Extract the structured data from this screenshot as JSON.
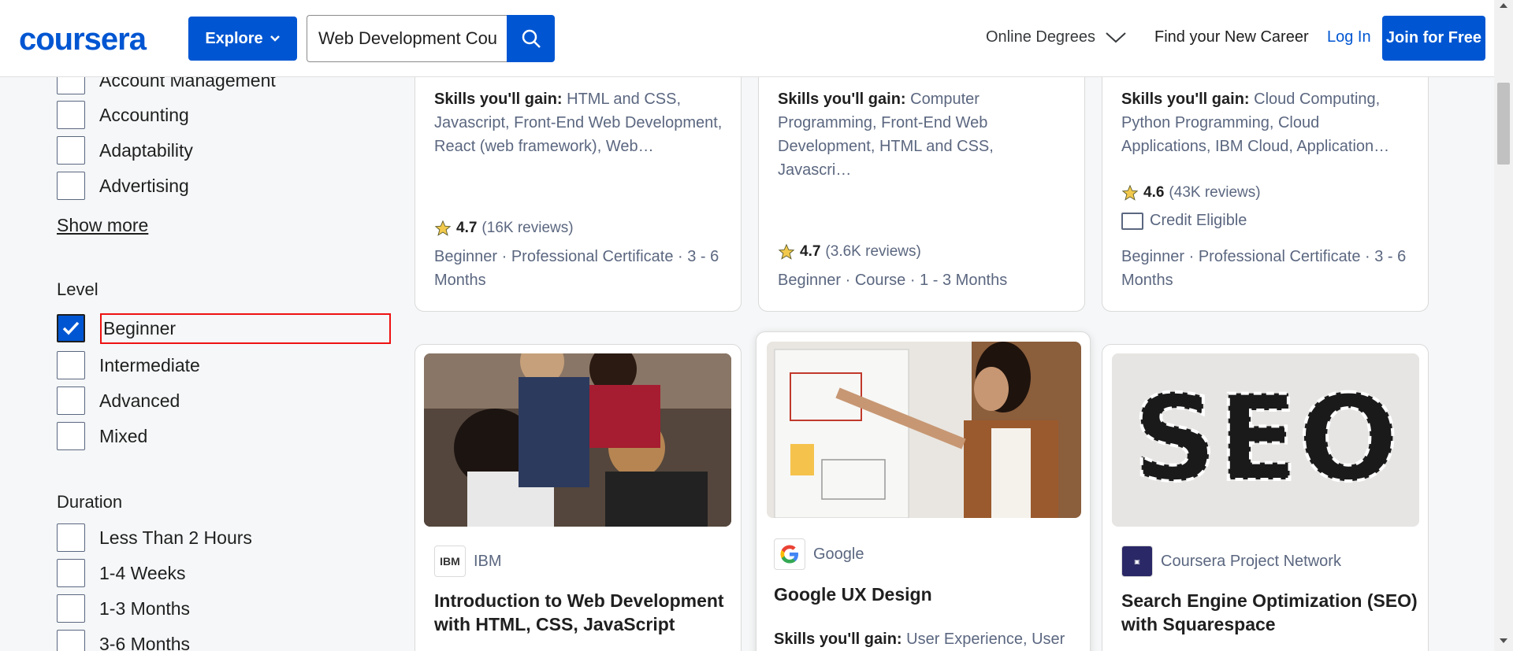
{
  "header": {
    "logo": "coursera",
    "explore_label": "Explore",
    "search_value": "Web Development Cou",
    "nav_degrees": "Online Degrees",
    "nav_career": "Find your New Career",
    "login": "Log In",
    "join": "Join for Free"
  },
  "filters": {
    "skills_items": [
      "Account Management",
      "Accounting",
      "Adaptability",
      "Advertising"
    ],
    "show_more": "Show more",
    "level_title": "Level",
    "level_items": [
      "Beginner",
      "Intermediate",
      "Advanced",
      "Mixed"
    ],
    "level_checked": "Beginner",
    "duration_title": "Duration",
    "duration_items": [
      "Less Than 2 Hours",
      "1-4 Weeks",
      "1-3 Months",
      "3-6 Months"
    ]
  },
  "cards_top": [
    {
      "skills_label": "Skills you'll gain:",
      "skills_lines": [
        "HTML and CSS,",
        "Javascript, Front-End Web Development,",
        "React (web framework), Web…"
      ],
      "rating": "4.7",
      "reviews": "(16K reviews)",
      "meta_lines": [
        "Beginner · Professional Certificate · 3 - 6",
        "Months"
      ]
    },
    {
      "skills_label": "Skills you'll gain:",
      "skills_lines": [
        "Computer",
        "Programming, Front-End Web",
        "Development, HTML and CSS, Javascri…"
      ],
      "rating": "4.7",
      "reviews": "(3.6K reviews)",
      "meta_lines": [
        "Beginner · Course · 1 - 3 Months"
      ]
    },
    {
      "skills_label": "Skills you'll gain:",
      "skills_lines": [
        "Cloud Computing,",
        "Python Programming, Cloud",
        "Applications, IBM Cloud, Application…"
      ],
      "rating": "4.6",
      "reviews": "(43K reviews)",
      "credit": "Credit Eligible",
      "meta_lines": [
        "Beginner · Professional Certificate · 3 - 6",
        "Months"
      ]
    }
  ],
  "cards_bottom": [
    {
      "partner": "IBM",
      "title_lines": [
        "Introduction to Web Development",
        "with HTML, CSS, JavaScript"
      ]
    },
    {
      "partner": "Google",
      "title_lines": [
        "Google UX Design"
      ],
      "skills_label": "Skills you'll gain:",
      "skills_text": "User Experience, User"
    },
    {
      "partner": "Coursera Project Network",
      "title_lines": [
        "Search Engine Optimization (SEO)",
        "with Squarespace"
      ],
      "image_text": "SEO"
    }
  ],
  "colors": {
    "brand": "#0056d2",
    "star": "#f2c94c",
    "highlight": "#e11111"
  }
}
